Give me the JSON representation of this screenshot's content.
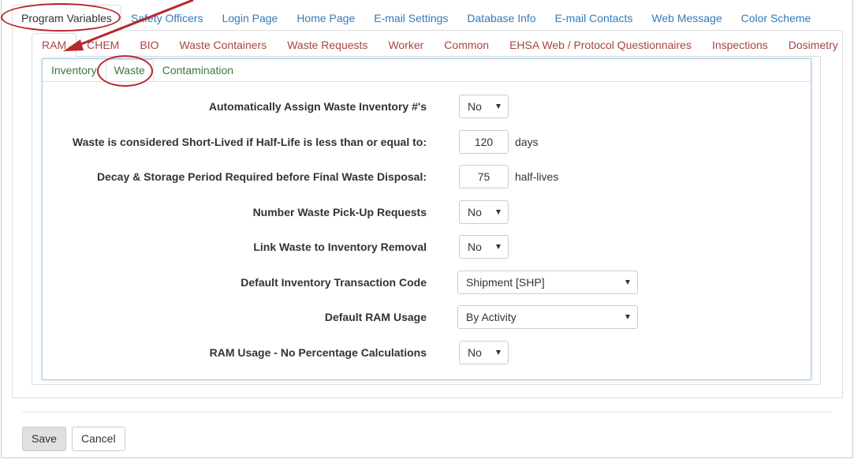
{
  "top_tabs": [
    {
      "label": "Program Variables",
      "active": true
    },
    {
      "label": "Safety Officers"
    },
    {
      "label": "Login Page"
    },
    {
      "label": "Home Page"
    },
    {
      "label": "E-mail Settings"
    },
    {
      "label": "Database Info"
    },
    {
      "label": "E-mail Contacts"
    },
    {
      "label": "Web Message"
    },
    {
      "label": "Color Scheme"
    }
  ],
  "sub_tabs": [
    {
      "label": "RAM",
      "active": true
    },
    {
      "label": "CHEM"
    },
    {
      "label": "BIO"
    },
    {
      "label": "Waste Containers"
    },
    {
      "label": "Waste Requests"
    },
    {
      "label": "Worker"
    },
    {
      "label": "Common"
    },
    {
      "label": "EHSA Web / Protocol Questionnaires"
    },
    {
      "label": "Inspections"
    },
    {
      "label": "Dosimetry"
    }
  ],
  "inner_tabs": [
    {
      "label": "Inventory"
    },
    {
      "label": "Waste",
      "active": true
    },
    {
      "label": "Contamination"
    }
  ],
  "form": {
    "auto_assign": {
      "label": "Automatically Assign Waste Inventory #'s",
      "value": "No"
    },
    "short_lived": {
      "label": "Waste is considered Short-Lived if Half-Life is less than or equal to:",
      "value": "120",
      "unit": "days"
    },
    "decay_period": {
      "label": "Decay & Storage Period Required before Final Waste Disposal:",
      "value": "75",
      "unit": "half-lives"
    },
    "number_pickup": {
      "label": "Number Waste Pick-Up Requests",
      "value": "No"
    },
    "link_removal": {
      "label": "Link Waste to Inventory Removal",
      "value": "No"
    },
    "transaction_code": {
      "label": "Default Inventory Transaction Code",
      "value": "Shipment [SHP]"
    },
    "ram_usage": {
      "label": "Default RAM Usage",
      "value": "By Activity"
    },
    "no_percentage": {
      "label": "RAM Usage - No Percentage Calculations",
      "value": "No"
    }
  },
  "buttons": {
    "save": "Save",
    "cancel": "Cancel"
  },
  "colors": {
    "link_blue": "#337ab7",
    "tab_red": "#a94442",
    "tab_green": "#3c763d",
    "annotation_red": "#b8272d"
  }
}
